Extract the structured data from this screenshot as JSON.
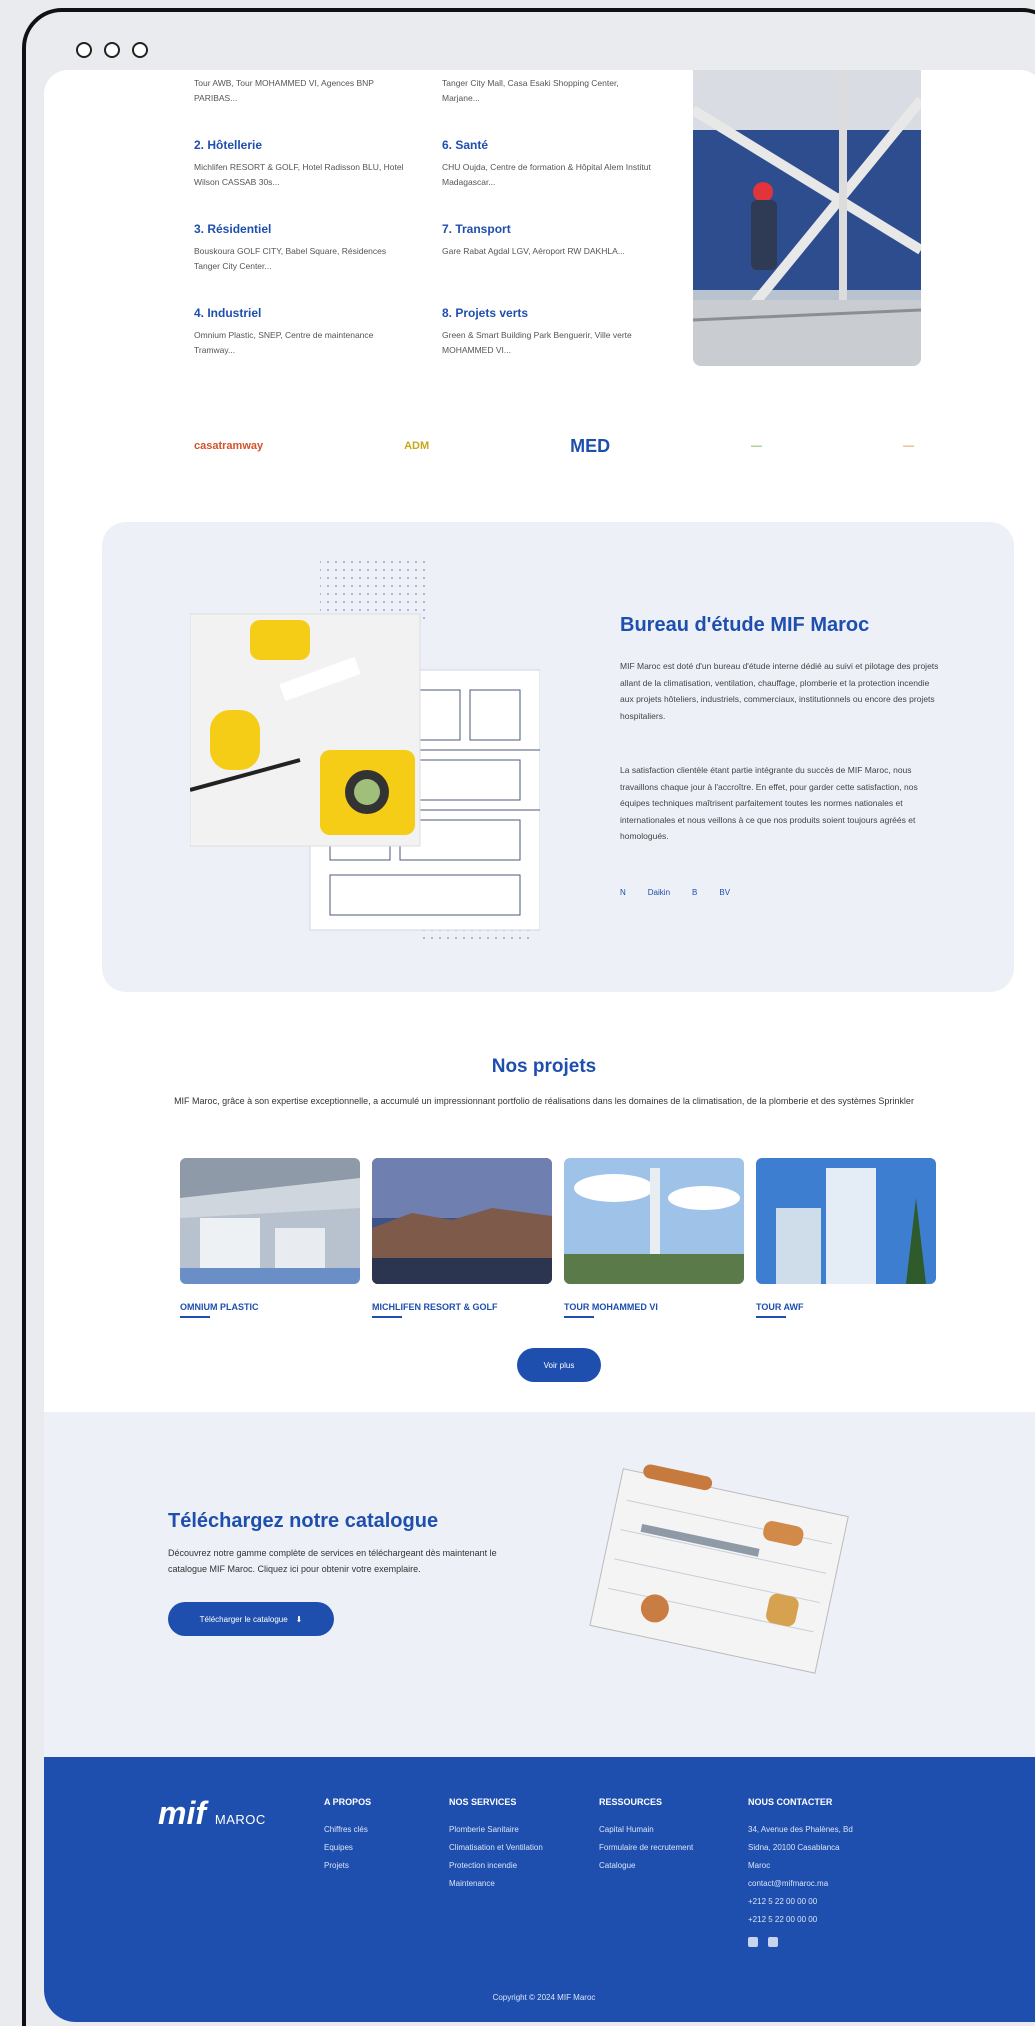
{
  "categories": [
    {
      "title": "",
      "text": "Tour AWB, Tour MOHAMMED VI, Agences BNP PARIBAS..."
    },
    {
      "title": "2. Hôtellerie",
      "text": "Michlifen RESORT & GOLF, Hotel Radisson BLU, Hotel Wilson CASSAB 30s..."
    },
    {
      "title": "3. Résidentiel",
      "text": "Bouskoura GOLF CITY, Babel Square, Résidences Tanger City Center..."
    },
    {
      "title": "4. Industriel",
      "text": "Omnium Plastic, SNEP, Centre de maintenance Tramway..."
    },
    {
      "title": "",
      "text": "Tanger City Mall, Casa Esaki Shopping Center, Marjane..."
    },
    {
      "title": "6. Santé",
      "text": "CHU Oujda, Centre de formation & Hôpital Alem Institut Madagascar..."
    },
    {
      "title": "7. Transport",
      "text": "Gare Rabat Agdal LGV, Aéroport RW DAKHLA..."
    },
    {
      "title": "8. Projets verts",
      "text": "Green & Smart Building Park Benguerir, Ville verte MOHAMMED VI..."
    }
  ],
  "partners": [
    "casatramway",
    "ADM",
    "MED",
    "—",
    "—"
  ],
  "bureau": {
    "title": "Bureau d'étude MIF Maroc",
    "p1": "MIF Maroc est doté d'un bureau d'étude interne dédié au suivi et pilotage des projets allant de la climatisation, ventilation, chauffage, plomberie et la protection incendie aux projets hôteliers, industriels, commerciaux, institutionnels ou encore des projets hospitaliers.",
    "p2": "La satisfaction clientèle étant partie intégrante du succès de MIF Maroc, nous travaillons chaque jour à l'accroître. En effet, pour garder cette satisfaction, nos équipes techniques maîtrisent parfaitement toutes les normes nationales et internationales et nous veillons à ce que nos produits soient toujours agréés et homologués.",
    "certs": [
      "N",
      "Daikin",
      "B",
      "BV"
    ]
  },
  "projets": {
    "title": "Nos projets",
    "lead": "MIF Maroc, grâce à son expertise exceptionnelle, a accumulé un impressionnant portfolio de réalisations dans les domaines de la climatisation, de la plomberie et des systèmes Sprinkler",
    "cards": [
      {
        "title": "OMNIUM PLASTIC"
      },
      {
        "title": "MICHLIFEN RESORT & GOLF"
      },
      {
        "title": "TOUR MOHAMMED VI"
      },
      {
        "title": "TOUR AWF"
      }
    ],
    "voir": "Voir plus"
  },
  "catalogue": {
    "title": "Téléchargez notre catalogue",
    "text": "Découvrez notre gamme complète de services en téléchargeant dès maintenant le catalogue MIF Maroc. Cliquez ici pour obtenir votre exemplaire.",
    "button": "Télécharger le catalogue"
  },
  "footer": {
    "logo": "mif",
    "logo_sub": "MAROC",
    "cols": [
      {
        "title": "A PROPOS",
        "items": [
          "Chiffres clés",
          "Equipes",
          "Projets"
        ]
      },
      {
        "title": "NOS SERVICES",
        "items": [
          "Plomberie Sanitaire",
          "Climatisation et Ventilation",
          "Protection incendie",
          "Maintenance"
        ]
      },
      {
        "title": "RESSOURCES",
        "items": [
          "Capital Humain",
          "Formulaire de recrutement",
          "Catalogue"
        ]
      },
      {
        "title": "NOUS CONTACTER",
        "items": [
          "34, Avenue des Phalènes, Bd",
          "Sidna, 20100 Casablanca",
          "Maroc",
          "contact@mifmaroc.ma",
          "+212 5 22 00 00 00",
          "+212 5 22 00 00 00"
        ]
      }
    ],
    "copyright": "Copyright © 2024 MIF Maroc"
  }
}
